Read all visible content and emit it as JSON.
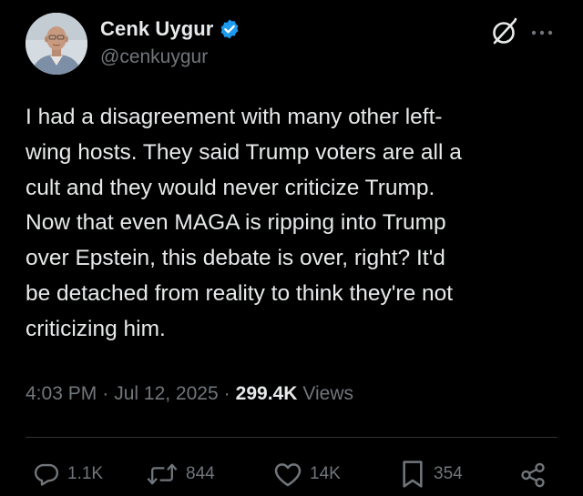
{
  "author": {
    "display_name": "Cenk Uygur",
    "handle": "@cenkuygur",
    "verified": true
  },
  "tweet": {
    "text": "I had a disagreement with many other left-\nwing hosts. They said Trump voters are all a\ncult and they would never criticize Trump.\nNow that even MAGA is ripping into Trump\nover Epstein, this debate is over, right? It'd\nbe detached from reality to think they're not\ncriticizing him."
  },
  "meta": {
    "time": "4:03 PM",
    "separator": "·",
    "date": "Jul 12, 2025",
    "views_count": "299.4K",
    "views_label": "Views"
  },
  "actions": {
    "replies": "1.1K",
    "reposts": "844",
    "likes": "14K",
    "bookmarks": "354"
  },
  "icons": {
    "verified": "verified-badge-icon",
    "grok": "grok-icon",
    "more": "more-icon",
    "reply": "reply-icon",
    "repost": "repost-icon",
    "like": "heart-icon",
    "bookmark": "bookmark-icon",
    "share": "share-icon"
  },
  "colors": {
    "background": "#000000",
    "text_primary": "#e7e9ea",
    "text_secondary": "#71767b",
    "verified_blue": "#1d9bf0",
    "divider": "#2f3336"
  }
}
